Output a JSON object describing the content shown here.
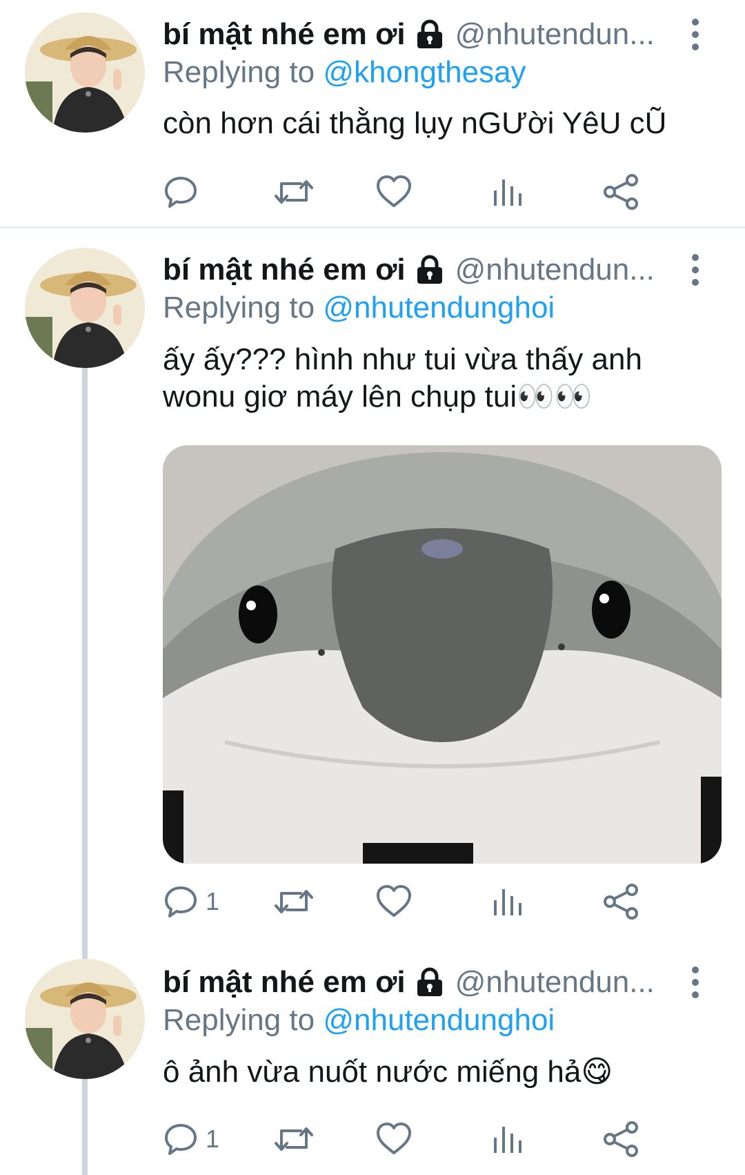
{
  "tweets": [
    {
      "display_name": "bí mật nhé em ơi",
      "handle": "@nhutendun...",
      "replying_prefix": "Replying to ",
      "replying_to": "@khongthesay",
      "text": "còn hơn cái thằng lụy nGƯời YêU cŨ",
      "reply_count": "",
      "avatar_caption": "Bí mật nhé em ơi"
    },
    {
      "display_name": "bí mật nhé em ơi",
      "handle": "@nhutendun...",
      "replying_prefix": "Replying to ",
      "replying_to": "@nhutendunghoi",
      "text": "ấy ấy??? hình như tui vừa thấy anh wonu giơ máy lên chụp tui👀👀",
      "reply_count": "1",
      "avatar_caption": "Bí mật nhé em ơi"
    },
    {
      "display_name": "bí mật nhé em ơi",
      "handle": "@nhutendun...",
      "replying_prefix": "Replying to ",
      "replying_to": "@nhutendunghoi",
      "text": "ô ảnh vừa nuốt nước miếng hả😋",
      "reply_count": "1",
      "avatar_caption": "Bí mật nhé em ơi"
    }
  ],
  "icons": {
    "lock": "lock-icon",
    "more": "more-vertical-icon",
    "reply": "reply-icon",
    "retweet": "retweet-icon",
    "like": "like-icon",
    "analytics": "analytics-icon",
    "share": "share-icon"
  },
  "colors": {
    "link": "#1da1f2",
    "secondary_text": "#657786",
    "primary_text": "#14171a",
    "thread_line": "#ccd6dd",
    "divider": "#e6ecf0"
  }
}
